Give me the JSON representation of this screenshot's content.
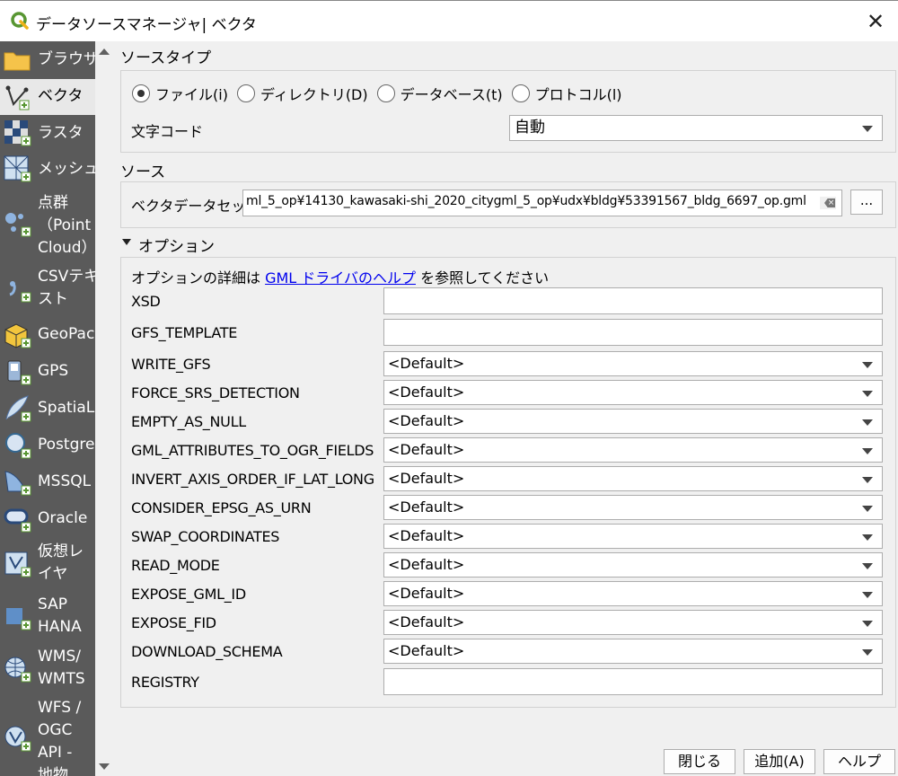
{
  "window": {
    "title": "データソースマネージャ| ベクタ",
    "close_symbol": "✕"
  },
  "sidebar": {
    "items": [
      {
        "label": "ブラウザ",
        "icon": "folder-icon"
      },
      {
        "label": "ベクタ",
        "icon": "vector-icon"
      },
      {
        "label": "ラスタ",
        "icon": "raster-icon"
      },
      {
        "label": "メッシュ",
        "icon": "mesh-icon"
      },
      {
        "label": "点群\n（Point\nCloud）",
        "icon": "point-cloud-icon"
      },
      {
        "label": "CSVテキ\nスト",
        "icon": "csv-icon"
      },
      {
        "label": "GeoPack",
        "icon": "geopackage-icon"
      },
      {
        "label": "GPS",
        "icon": "gps-icon"
      },
      {
        "label": "SpatiaLi",
        "icon": "spatialite-icon"
      },
      {
        "label": "Postgre",
        "icon": "postgres-icon"
      },
      {
        "label": "MSSQL",
        "icon": "mssql-icon"
      },
      {
        "label": "Oracle",
        "icon": "oracle-icon"
      },
      {
        "label": "仮想レ\nイヤ",
        "icon": "virtual-layer-icon"
      },
      {
        "label": "SAP\nHANA",
        "icon": "sap-hana-icon"
      },
      {
        "label": "WMS/\nWMTS",
        "icon": "wms-icon"
      },
      {
        "label": "WFS /\nOGC\nAPI -\n地物",
        "icon": "wfs-icon"
      }
    ]
  },
  "source_type": {
    "heading": "ソースタイプ",
    "options": [
      {
        "label": "ファイル(i)",
        "selected": true
      },
      {
        "label": "ディレクトリ(D)",
        "selected": false
      },
      {
        "label": "データベース(t)",
        "selected": false
      },
      {
        "label": "プロトコル(l)",
        "selected": false
      }
    ],
    "encoding_label": "文字コード",
    "encoding_value": "自動"
  },
  "source": {
    "heading": "ソース",
    "dataset_label": "ベクタデータセット",
    "dataset_value": "ml_5_op¥14130_kawasaki-shi_2020_citygml_5_op¥udx¥bldg¥53391567_bldg_6697_op.gml",
    "browse_label": "..."
  },
  "options": {
    "heading": "オプション",
    "hint_prefix": "オプションの詳細は ",
    "hint_link": "GML ドライバのヘルプ",
    "hint_suffix": " を参照してください",
    "fields": [
      {
        "label": "XSD",
        "kind": "text",
        "value": ""
      },
      {
        "label": "GFS_TEMPLATE",
        "kind": "text",
        "value": ""
      },
      {
        "label": "WRITE_GFS",
        "kind": "combo",
        "value": "<Default>"
      },
      {
        "label": "FORCE_SRS_DETECTION",
        "kind": "combo",
        "value": "<Default>"
      },
      {
        "label": "EMPTY_AS_NULL",
        "kind": "combo",
        "value": "<Default>"
      },
      {
        "label": "GML_ATTRIBUTES_TO_OGR_FIELDS",
        "kind": "combo",
        "value": "<Default>"
      },
      {
        "label": "INVERT_AXIS_ORDER_IF_LAT_LONG",
        "kind": "combo",
        "value": "<Default>"
      },
      {
        "label": "CONSIDER_EPSG_AS_URN",
        "kind": "combo",
        "value": "<Default>"
      },
      {
        "label": "SWAP_COORDINATES",
        "kind": "combo",
        "value": "<Default>"
      },
      {
        "label": "READ_MODE",
        "kind": "combo",
        "value": "<Default>"
      },
      {
        "label": "EXPOSE_GML_ID",
        "kind": "combo",
        "value": "<Default>"
      },
      {
        "label": "EXPOSE_FID",
        "kind": "combo",
        "value": "<Default>"
      },
      {
        "label": "DOWNLOAD_SCHEMA",
        "kind": "combo",
        "value": "<Default>"
      },
      {
        "label": "REGISTRY",
        "kind": "text",
        "value": ""
      }
    ]
  },
  "buttons": {
    "close": "閉じる",
    "add": "追加(A)",
    "help": "ヘルプ"
  },
  "colors": {
    "sidebar_bg": "#5a5a5a",
    "link": "#0000ee",
    "qgis_green": "#589632"
  }
}
